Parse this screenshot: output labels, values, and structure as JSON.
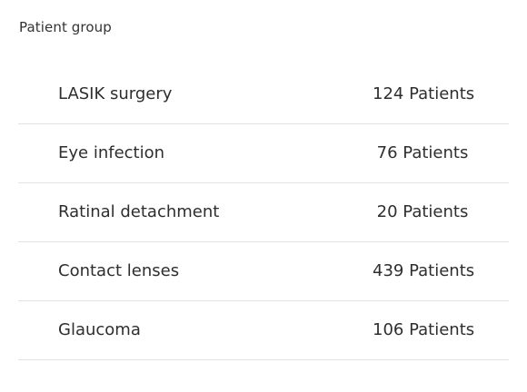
{
  "card": {
    "title": "Patient group"
  },
  "groups": [
    {
      "name": "LASIK surgery",
      "count": "124 Patients"
    },
    {
      "name": "Eye infection",
      "count": "76 Patients"
    },
    {
      "name": "Ratinal detachment",
      "count": "20 Patients"
    },
    {
      "name": "Contact lenses",
      "count": "439 Patients"
    },
    {
      "name": "Glaucoma",
      "count": "106 Patients"
    }
  ]
}
